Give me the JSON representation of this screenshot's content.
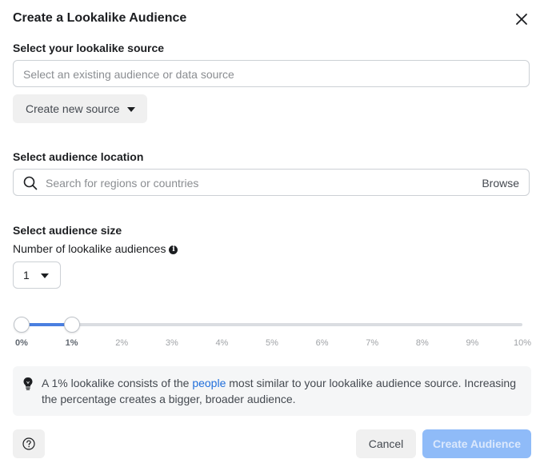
{
  "dialog": {
    "title": "Create a Lookalike Audience",
    "close_icon": "close-icon"
  },
  "source": {
    "label": "Select your lookalike source",
    "placeholder": "Select an existing audience or data source",
    "create_button": "Create new source"
  },
  "location": {
    "label": "Select audience location",
    "placeholder": "Search for regions or countries",
    "browse": "Browse"
  },
  "size": {
    "label": "Select audience size",
    "count_label": "Number of lookalike audiences",
    "count_value": "1",
    "slider": {
      "min_percent": 0,
      "max_percent": 10,
      "selected_start_percent": 0,
      "selected_end_percent": 1,
      "ticks": [
        "0%",
        "1%",
        "2%",
        "3%",
        "4%",
        "5%",
        "6%",
        "7%",
        "8%",
        "9%",
        "10%"
      ]
    }
  },
  "tip": {
    "text_before": "A 1% lookalike consists of the ",
    "link": "people",
    "text_after": " most similar to your lookalike audience source. Increasing the percentage creates a bigger, broader audience."
  },
  "footer": {
    "cancel": "Cancel",
    "create": "Create Audience"
  },
  "colors": {
    "accent": "#4a7fe0",
    "link": "#216fdb",
    "disabled_primary": "#8fbbf8"
  }
}
